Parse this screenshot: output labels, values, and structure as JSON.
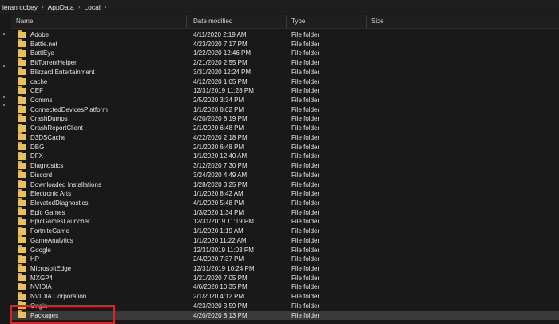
{
  "breadcrumb": [
    "ieran cobey",
    "AppData",
    "Local"
  ],
  "columns": {
    "name": "Name",
    "date": "Date modified",
    "type": "Type",
    "size": "Size"
  },
  "rows": [
    {
      "name": "Adobe",
      "date": "4/11/2020 2:19 AM",
      "type": "File folder"
    },
    {
      "name": "Battle.net",
      "date": "4/23/2020 7:17 PM",
      "type": "File folder"
    },
    {
      "name": "BattlEye",
      "date": "1/22/2020 12:46 PM",
      "type": "File folder"
    },
    {
      "name": "BitTorrentHelper",
      "date": "2/21/2020 2:55 PM",
      "type": "File folder"
    },
    {
      "name": "Blizzard Entertainment",
      "date": "3/31/2020 12:24 PM",
      "type": "File folder"
    },
    {
      "name": "cache",
      "date": "4/12/2020 1:05 PM",
      "type": "File folder"
    },
    {
      "name": "CEF",
      "date": "12/31/2019 11:28 PM",
      "type": "File folder"
    },
    {
      "name": "Comms",
      "date": "2/5/2020 3:34 PM",
      "type": "File folder"
    },
    {
      "name": "ConnectedDevicesPlatform",
      "date": "1/1/2020 8:02 PM",
      "type": "File folder"
    },
    {
      "name": "CrashDumps",
      "date": "4/20/2020 8:19 PM",
      "type": "File folder"
    },
    {
      "name": "CrashReportClient",
      "date": "2/1/2020 6:48 PM",
      "type": "File folder"
    },
    {
      "name": "D3DSCache",
      "date": "4/22/2020 2:18 PM",
      "type": "File folder"
    },
    {
      "name": "DBG",
      "date": "2/1/2020 6:48 PM",
      "type": "File folder"
    },
    {
      "name": "DFX",
      "date": "1/1/2020 12:40 AM",
      "type": "File folder"
    },
    {
      "name": "Diagnostics",
      "date": "3/12/2020 7:30 PM",
      "type": "File folder"
    },
    {
      "name": "Discord",
      "date": "3/24/2020 4:49 AM",
      "type": "File folder"
    },
    {
      "name": "Downloaded Installations",
      "date": "1/28/2020 3:25 PM",
      "type": "File folder"
    },
    {
      "name": "Electronic Arts",
      "date": "1/1/2020 8:42 AM",
      "type": "File folder"
    },
    {
      "name": "ElevatedDiagnostics",
      "date": "4/1/2020 5:48 PM",
      "type": "File folder"
    },
    {
      "name": "Epic Games",
      "date": "1/3/2020 1:34 PM",
      "type": "File folder"
    },
    {
      "name": "EpicGamesLauncher",
      "date": "12/31/2019 11:19 PM",
      "type": "File folder"
    },
    {
      "name": "FortniteGame",
      "date": "1/1/2020 1:19 AM",
      "type": "File folder"
    },
    {
      "name": "GameAnalytics",
      "date": "1/1/2020 11:22 AM",
      "type": "File folder"
    },
    {
      "name": "Google",
      "date": "12/31/2019 11:03 PM",
      "type": "File folder"
    },
    {
      "name": "HP",
      "date": "2/4/2020 7:37 PM",
      "type": "File folder"
    },
    {
      "name": "MicrosoftEdge",
      "date": "12/31/2019 10:24 PM",
      "type": "File folder"
    },
    {
      "name": "MXGP4",
      "date": "1/21/2020 7:05 PM",
      "type": "File folder"
    },
    {
      "name": "NVIDIA",
      "date": "4/6/2020 10:35 PM",
      "type": "File folder"
    },
    {
      "name": "NVIDIA Corporation",
      "date": "2/1/2020 4:12 PM",
      "type": "File folder"
    },
    {
      "name": "Origin",
      "date": "4/23/2020 3:59 PM",
      "type": "File folder"
    },
    {
      "name": "Packages",
      "date": "4/20/2020 8:13 PM",
      "type": "File folder"
    }
  ],
  "selected_row": 30,
  "colors": {
    "background": "#191919",
    "folder": "#e8c15a",
    "highlight": "#e01f26",
    "selected": "#3a3a3a"
  }
}
